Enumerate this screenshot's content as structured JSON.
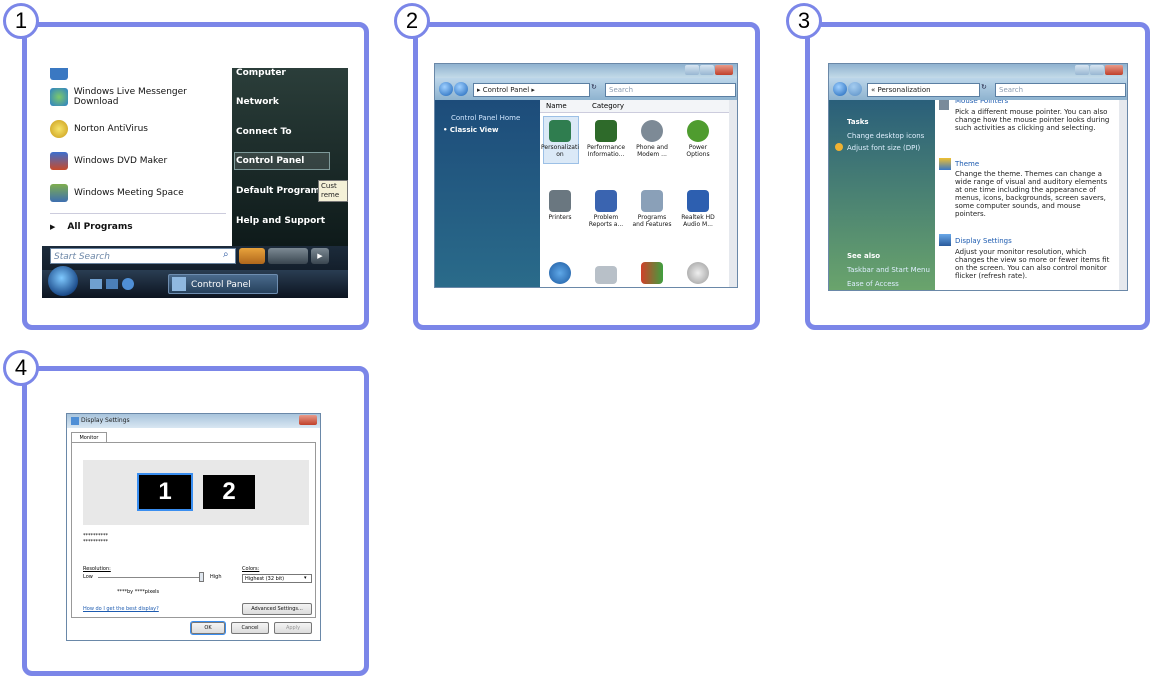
{
  "steps": [
    "1",
    "2",
    "3",
    "4"
  ],
  "start_menu": {
    "programs": [
      "Windows Live Messenger Download",
      "Norton AntiVirus",
      "Windows DVD Maker",
      "Windows Meeting Space"
    ],
    "all_programs": "All Programs",
    "right_items": [
      "Computer",
      "Network",
      "Connect To",
      "Control Panel",
      "Default Programs",
      "Help and Support"
    ],
    "tooltip": "Cust reme",
    "search_placeholder": "Start Search",
    "taskbar_item": "Control Panel"
  },
  "control_panel": {
    "breadcrumb": "▸ Control Panel ▸",
    "search_placeholder": "Search",
    "sidebar": [
      "Control Panel Home",
      "Classic View"
    ],
    "columns": [
      "Name",
      "Category"
    ],
    "icons": [
      {
        "label": "Personalizati on",
        "color": "#2f7d4f"
      },
      {
        "label": "Performance Informatio...",
        "color": "#2e6a2a"
      },
      {
        "label": "Phone and Modem ...",
        "color": "#7d8a96"
      },
      {
        "label": "Power Options",
        "color": "#4f9c2f"
      },
      {
        "label": "Printers",
        "color": "#6a7780"
      },
      {
        "label": "Problem Reports a...",
        "color": "#3a64b0"
      },
      {
        "label": "Programs and Features",
        "color": "#8aa0b8"
      },
      {
        "label": "Realtek HD Audio M...",
        "color": "#2d5fb0"
      }
    ]
  },
  "personalization": {
    "breadcrumb": "« Personalization",
    "search_placeholder": "Search",
    "tasks_heading": "Tasks",
    "tasks": [
      "Change desktop icons",
      "Adjust font size (DPI)"
    ],
    "see_also_heading": "See also",
    "see_also": [
      "Taskbar and Start Menu",
      "Ease of Access"
    ],
    "entries": [
      {
        "title": "Mouse Pointers",
        "desc": "Pick a different mouse pointer. You can also change how the mouse pointer looks during such activities as clicking and selecting."
      },
      {
        "title": "Theme",
        "desc": "Change the theme. Themes can change a wide range of visual and auditory elements at one time including the appearance of menus, icons, backgrounds, screen savers, some computer sounds, and mouse pointers."
      },
      {
        "title": "Display Settings",
        "desc": "Adjust your monitor resolution, which changes the view so more or fewer items fit on the screen. You can also control monitor flicker (refresh rate)."
      }
    ]
  },
  "display_settings": {
    "title": "Display Settings",
    "tab": "Monitor",
    "monitors": [
      "1",
      "2"
    ],
    "masked_lines": [
      "**********",
      "**********"
    ],
    "resolution_label": "Resolution:",
    "low": "Low",
    "high": "High",
    "pixels": "****by ****pixels",
    "colors_label": "Colors:",
    "colors_value": "Highest (32 bit)",
    "help_link": "How do I get the best display?",
    "advanced_button": "Advanced Settings...",
    "ok": "OK",
    "cancel": "Cancel",
    "apply": "Apply"
  }
}
